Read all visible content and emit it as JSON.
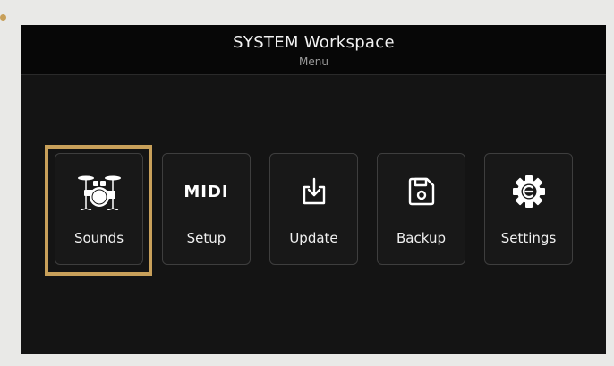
{
  "header": {
    "title": "SYSTEM Workspace",
    "subtitle": "Menu"
  },
  "menu": {
    "items": [
      {
        "label": "Sounds",
        "icon": "drum-kit-icon",
        "selected": true
      },
      {
        "label": "Setup",
        "icon": "midi-icon",
        "icon_text": "MIDI",
        "selected": false
      },
      {
        "label": "Update",
        "icon": "download-tray-icon",
        "selected": false
      },
      {
        "label": "Backup",
        "icon": "floppy-disk-icon",
        "selected": false
      },
      {
        "label": "Settings",
        "icon": "gear-icon",
        "selected": false
      }
    ]
  },
  "colors": {
    "focus_ring": "#c8a05a",
    "screen_background": "#141414",
    "tile_border": "#3e3e3e"
  }
}
